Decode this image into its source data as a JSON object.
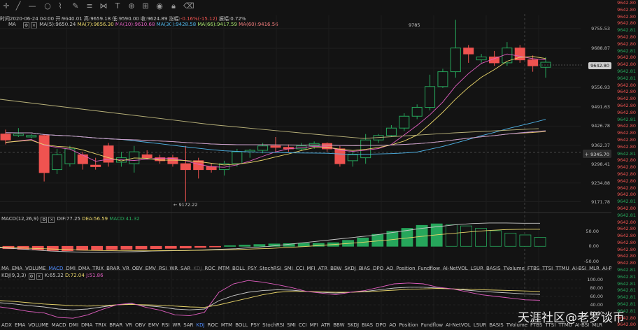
{
  "ohlc_line": {
    "time": "时间2020-06-24 04:00",
    "open": "开:9640.01",
    "high": "高:9659.18",
    "low": "低:9590.00",
    "close": "收:9624.89",
    "change_label": "涨幅:",
    "change": "-0.16%(-15.12)",
    "amplitude": "振幅:0.72%"
  },
  "ma_legend": {
    "name": "MA",
    "ma5": "MA(5):9650.24",
    "ma7": "MA(7):9656.30",
    "ma10": "MA(10):9610.68",
    "ma30": "MA(30):9428.58",
    "ma66": "MA(66):9417.59",
    "ma60": "MA(60):9416.56"
  },
  "macd_legend": {
    "name": "MACD(12,26,9)",
    "dif": "DIF:77.25",
    "dea": "DEA:56.59",
    "macd": "MACD:41.32"
  },
  "kdj_legend": {
    "name": "KDJ(9,3,3)",
    "k": "K:65.32",
    "d": "D:72.04",
    "j": "J:51.86"
  },
  "price_axis": {
    "labels": [
      "9755.53",
      "9688.87",
      "9622.68",
      "9556.93",
      "9491.63",
      "9426.78",
      "9362.37",
      "9298.41",
      "9234.88",
      "9171.78"
    ],
    "current": "9642.80",
    "crosshair": "9345.70"
  },
  "macd_axis": [
    "50.00",
    "0.00",
    "-50.00"
  ],
  "kdj_axis": [
    "100.00",
    "80.00",
    "60.00",
    "40.00",
    "20.00"
  ],
  "annotations": {
    "high": "9785",
    "low": "9172.22"
  },
  "indicator_tabs_1": [
    "MA",
    "EMA",
    "VOLUME",
    "MACD",
    "DMI",
    "DMA",
    "TRIX",
    "BRAR",
    "VR",
    "OBV",
    "EMV",
    "RSI",
    "WR",
    "SAR",
    "KDJ",
    "ROC",
    "MTM",
    "BOLL",
    "PSY",
    "StochRSI",
    "SMI",
    "CCI",
    "MFI",
    "ATR",
    "BBW",
    "SKDJ",
    "BIAS",
    "DPO",
    "AO",
    "Position",
    "Fundflow",
    "AI-NetVOL",
    "LSUR",
    "BASIS",
    "TVolume",
    "FTBS",
    "TTSI",
    "TTMU",
    "AI-BSI",
    "MLR",
    "AI-PD",
    "AI-FDI",
    "AI-LI",
    "FR"
  ],
  "indicator_tabs_2": [
    "ADX",
    "EMA",
    "VOLUME",
    "MACD",
    "DMI",
    "DMA",
    "TRIX",
    "BRAR",
    "VR",
    "OBV",
    "EMV",
    "RSI",
    "WR",
    "SAR",
    "KDJ",
    "ROC",
    "MTM",
    "BOLL",
    "PSY",
    "StochRSI",
    "SMI",
    "CCI",
    "MFI",
    "ATR",
    "BBW",
    "SKDJ",
    "BIAS",
    "DPO",
    "AO",
    "Position",
    "Fundflow",
    "AI-NetVOL",
    "LSUR",
    "BASIS",
    "TVolume",
    "FTBS",
    "TTSI",
    "TTMU",
    "AI-BSI",
    "MLR"
  ],
  "right_ticker": [
    "9642.80",
    "9642.80",
    "9642.80",
    "9642.80",
    "9642.81",
    "9642.80",
    "9642.80",
    "9642.81",
    "9642.80",
    "9642.80",
    "9642.81",
    "9642.81",
    "9642.80",
    "9642.80",
    "9642.80",
    "9642.80",
    "9642.80",
    "9642.81",
    "9642.80",
    "9642.80",
    "9642.80",
    "9642.80",
    "9642.81",
    "9642.80",
    "9642.80",
    "9642.80",
    "9642.80",
    "9642.80",
    "9642.80",
    "9642.81",
    "9642.80",
    "9642.81",
    "9642.80",
    "9642.80",
    "9642.80",
    "9642.80",
    "9642.80",
    "9642.80",
    "9642.80",
    "9642.81",
    "9642.81",
    "9642.81",
    "9642.81",
    "9642.81",
    "9642.81",
    "9642.81",
    "9642.80",
    "9642.80"
  ],
  "watermark": "天涯社区@老罗谈币",
  "colors": {
    "up": "#26a65b",
    "down": "#ef5350",
    "bg": "#131313",
    "accent": "#4e8cff"
  },
  "chart_data": [
    {
      "type": "candlestick",
      "title": "",
      "ylim": [
        9140,
        9800
      ],
      "candles": [
        [
          9400,
          9415,
          9365,
          9380
        ],
        [
          9395,
          9420,
          9390,
          9400
        ],
        [
          9390,
          9400,
          9385,
          9395
        ],
        [
          9395,
          9400,
          9240,
          9270
        ],
        [
          9280,
          9350,
          9265,
          9330
        ],
        [
          9300,
          9360,
          9290,
          9350
        ],
        [
          9330,
          9340,
          9280,
          9300
        ],
        [
          9295,
          9320,
          9280,
          9290
        ],
        [
          9360,
          9370,
          9290,
          9305
        ],
        [
          9305,
          9340,
          9290,
          9320
        ],
        [
          9300,
          9360,
          9270,
          9340
        ],
        [
          9330,
          9345,
          9315,
          9320
        ],
        [
          9320,
          9330,
          9300,
          9310
        ],
        [
          9320,
          9330,
          9290,
          9300
        ],
        [
          9300,
          9360,
          9172,
          9280
        ],
        [
          9310,
          9320,
          9250,
          9280
        ],
        [
          9290,
          9300,
          9270,
          9280
        ],
        [
          9280,
          9310,
          9260,
          9300
        ],
        [
          9300,
          9350,
          9290,
          9340
        ],
        [
          9340,
          9350,
          9320,
          9345
        ],
        [
          9345,
          9370,
          9335,
          9360
        ],
        [
          9360,
          9390,
          9340,
          9355
        ],
        [
          9355,
          9365,
          9340,
          9350
        ],
        [
          9350,
          9370,
          9345,
          9360
        ],
        [
          9360,
          9375,
          9350,
          9368
        ],
        [
          9368,
          9372,
          9340,
          9350
        ],
        [
          9350,
          9360,
          9290,
          9300
        ],
        [
          9310,
          9340,
          9290,
          9330
        ],
        [
          9320,
          9400,
          9300,
          9380
        ],
        [
          9380,
          9400,
          9370,
          9395
        ],
        [
          9395,
          9430,
          9390,
          9420
        ],
        [
          9420,
          9470,
          9410,
          9460
        ],
        [
          9460,
          9500,
          9450,
          9490
        ],
        [
          9490,
          9600,
          9480,
          9560
        ],
        [
          9560,
          9620,
          9555,
          9610
        ],
        [
          9610,
          9785,
          9590,
          9690
        ],
        [
          9690,
          9700,
          9640,
          9670
        ],
        [
          9650,
          9670,
          9640,
          9660
        ],
        [
          9660,
          9680,
          9630,
          9640
        ],
        [
          9640,
          9710,
          9630,
          9690
        ],
        [
          9690,
          9700,
          9640,
          9650
        ],
        [
          9650,
          9665,
          9610,
          9630
        ],
        [
          9625,
          9659,
          9590,
          9642
        ]
      ]
    },
    {
      "type": "bar",
      "title": "",
      "ylim": [
        -60,
        80
      ],
      "values": [
        -8,
        -10,
        -12,
        -14,
        -15,
        -13,
        -12,
        -11,
        -10,
        -9,
        -8,
        -7,
        -6,
        -4,
        -2,
        2,
        4,
        6,
        8,
        9,
        10,
        10,
        12,
        20,
        28,
        40,
        50,
        60,
        70,
        75,
        72,
        68,
        60,
        52,
        44,
        38,
        30
      ],
      "dif": [
        -5,
        -8,
        -12,
        -16,
        -18,
        -20,
        -20,
        -19,
        -18,
        -16,
        -15,
        -14,
        -12,
        -10,
        -8,
        -4,
        0,
        6,
        12,
        18,
        24,
        30,
        36,
        44,
        52,
        60,
        66,
        72,
        76,
        78,
        78,
        77,
        77
      ],
      "dea": [
        -3,
        -5,
        -7,
        -9,
        -11,
        -13,
        -14,
        -15,
        -15,
        -15,
        -14,
        -14,
        -13,
        -12,
        -11,
        -9,
        -7,
        -4,
        -1,
        3,
        7,
        11,
        16,
        21,
        27,
        33,
        39,
        44,
        49,
        53,
        56,
        57,
        57
      ]
    },
    {
      "type": "line",
      "title": "",
      "ylim": [
        0,
        110
      ],
      "k": [
        45,
        42,
        38,
        35,
        30,
        28,
        30,
        35,
        40,
        42,
        38,
        35,
        30,
        28,
        30,
        50,
        62,
        70,
        74,
        76,
        75,
        72,
        70,
        68,
        70,
        72,
        76,
        80,
        82,
        82,
        80,
        78,
        75,
        72,
        70,
        68,
        66,
        65
      ],
      "d": [
        50,
        48,
        45,
        42,
        40,
        38,
        37,
        38,
        40,
        41,
        40,
        39,
        37,
        35,
        34,
        40,
        48,
        56,
        64,
        70,
        72,
        72,
        71,
        70,
        70,
        71,
        73,
        75,
        77,
        78,
        79,
        78,
        77,
        76,
        75,
        74,
        73,
        72
      ],
      "j": [
        35,
        30,
        24,
        21,
        10,
        8,
        16,
        29,
        40,
        44,
        34,
        27,
        16,
        14,
        22,
        70,
        90,
        98,
        94,
        88,
        81,
        72,
        68,
        64,
        70,
        74,
        82,
        90,
        92,
        90,
        82,
        78,
        71,
        64,
        60,
        56,
        52,
        51
      ]
    }
  ]
}
